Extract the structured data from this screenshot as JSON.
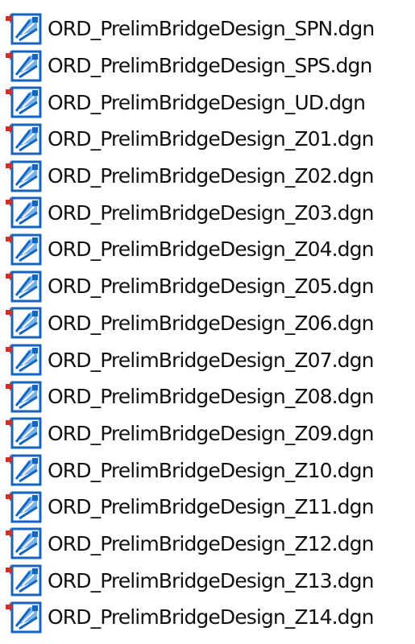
{
  "file_list": {
    "icon": "microstation-dgn-file-icon",
    "items": [
      {
        "name": "ORD_PrelimBridgeDesign_SPN.dgn"
      },
      {
        "name": "ORD_PrelimBridgeDesign_SPS.dgn"
      },
      {
        "name": "ORD_PrelimBridgeDesign_UD.dgn"
      },
      {
        "name": "ORD_PrelimBridgeDesign_Z01.dgn"
      },
      {
        "name": "ORD_PrelimBridgeDesign_Z02.dgn"
      },
      {
        "name": "ORD_PrelimBridgeDesign_Z03.dgn"
      },
      {
        "name": "ORD_PrelimBridgeDesign_Z04.dgn"
      },
      {
        "name": "ORD_PrelimBridgeDesign_Z05.dgn"
      },
      {
        "name": "ORD_PrelimBridgeDesign_Z06.dgn"
      },
      {
        "name": "ORD_PrelimBridgeDesign_Z07.dgn"
      },
      {
        "name": "ORD_PrelimBridgeDesign_Z08.dgn"
      },
      {
        "name": "ORD_PrelimBridgeDesign_Z09.dgn"
      },
      {
        "name": "ORD_PrelimBridgeDesign_Z10.dgn"
      },
      {
        "name": "ORD_PrelimBridgeDesign_Z11.dgn"
      },
      {
        "name": "ORD_PrelimBridgeDesign_Z12.dgn"
      },
      {
        "name": "ORD_PrelimBridgeDesign_Z13.dgn"
      },
      {
        "name": "ORD_PrelimBridgeDesign_Z14.dgn"
      }
    ],
    "colors": {
      "icon_blue": "#1565c0",
      "icon_light": "#7ab3e8",
      "icon_arrow": "#d0302a",
      "text": "#111111"
    }
  }
}
